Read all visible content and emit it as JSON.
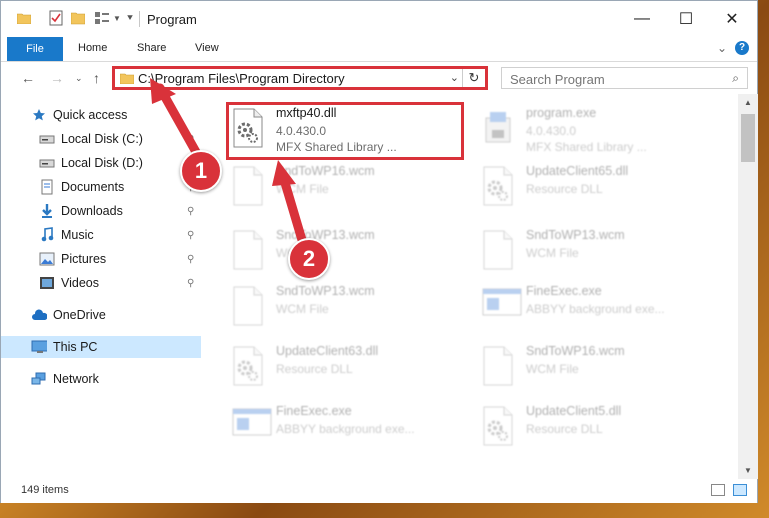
{
  "window": {
    "title": "Program",
    "controls": {
      "minimize": "—",
      "maximize": "☐",
      "close": "✕"
    }
  },
  "ribbon": {
    "tabs": [
      "File",
      "Home",
      "Share",
      "View"
    ],
    "help": "?"
  },
  "address": {
    "path": "C:\\Program Files\\Program Directory",
    "search_placeholder": "Search Program"
  },
  "sidebar": {
    "items": [
      {
        "label": "Quick access",
        "icon": "star-icon",
        "pinned": false
      },
      {
        "label": "Local Disk (C:)",
        "icon": "drive-icon",
        "pinned": true
      },
      {
        "label": "Local Disk (D:)",
        "icon": "drive-icon",
        "pinned": false
      },
      {
        "label": "Documents",
        "icon": "documents-icon",
        "pinned": true
      },
      {
        "label": "Downloads",
        "icon": "download-icon",
        "pinned": true
      },
      {
        "label": "Music",
        "icon": "music-icon",
        "pinned": true
      },
      {
        "label": "Pictures",
        "icon": "pictures-icon",
        "pinned": true
      },
      {
        "label": "Videos",
        "icon": "videos-icon",
        "pinned": true
      },
      {
        "label": "OneDrive",
        "icon": "cloud-icon",
        "pinned": false
      },
      {
        "label": "This PC",
        "icon": "computer-icon",
        "pinned": false,
        "selected": true
      },
      {
        "label": "Network",
        "icon": "network-icon",
        "pinned": false
      }
    ],
    "pin_glyph": "📌"
  },
  "files": [
    {
      "name": "mxftp40.dll",
      "line2": "4.0.430.0",
      "line3": "MFX Shared Library ...",
      "icon": "dll-gear-icon",
      "highlighted": true
    },
    {
      "name": "program.exe",
      "line2": "4.0.430.0",
      "line3": "MFX Shared Library ...",
      "icon": "exe-icon"
    },
    {
      "name": "SndToWP16.wcm",
      "line2": "WCM File",
      "line3": "",
      "icon": "blank-file-icon"
    },
    {
      "name": "UpdateClient65.dll",
      "line2": "Resource DLL",
      "line3": "",
      "icon": "dll-gear-icon"
    },
    {
      "name": "SndToWP13.wcm",
      "line2": "WCM File",
      "line3": "",
      "icon": "blank-file-icon"
    },
    {
      "name": "SndToWP13.wcm",
      "line2": "WCM File",
      "line3": "",
      "icon": "blank-file-icon"
    },
    {
      "name": "SndToWP13.wcm",
      "line2": "WCM File",
      "line3": "",
      "icon": "blank-file-icon"
    },
    {
      "name": "FineExec.exe",
      "line2": "ABBYY background exe...",
      "line3": "",
      "icon": "window-exe-icon"
    },
    {
      "name": "UpdateClient63.dll",
      "line2": "Resource DLL",
      "line3": "",
      "icon": "dll-gear-icon"
    },
    {
      "name": "SndToWP16.wcm",
      "line2": "WCM File",
      "line3": "",
      "icon": "blank-file-icon"
    },
    {
      "name": "FineExec.exe",
      "line2": "ABBYY background exe...",
      "line3": "",
      "icon": "window-exe-icon"
    },
    {
      "name": "UpdateClient5.dll",
      "line2": "Resource DLL",
      "line3": "",
      "icon": "dll-gear-icon"
    }
  ],
  "status": {
    "item_count": "149 items"
  },
  "callouts": [
    "1",
    "2"
  ],
  "colors": {
    "accent": "#1979ca",
    "highlight": "#d9323a",
    "selected": "#cce8ff"
  }
}
